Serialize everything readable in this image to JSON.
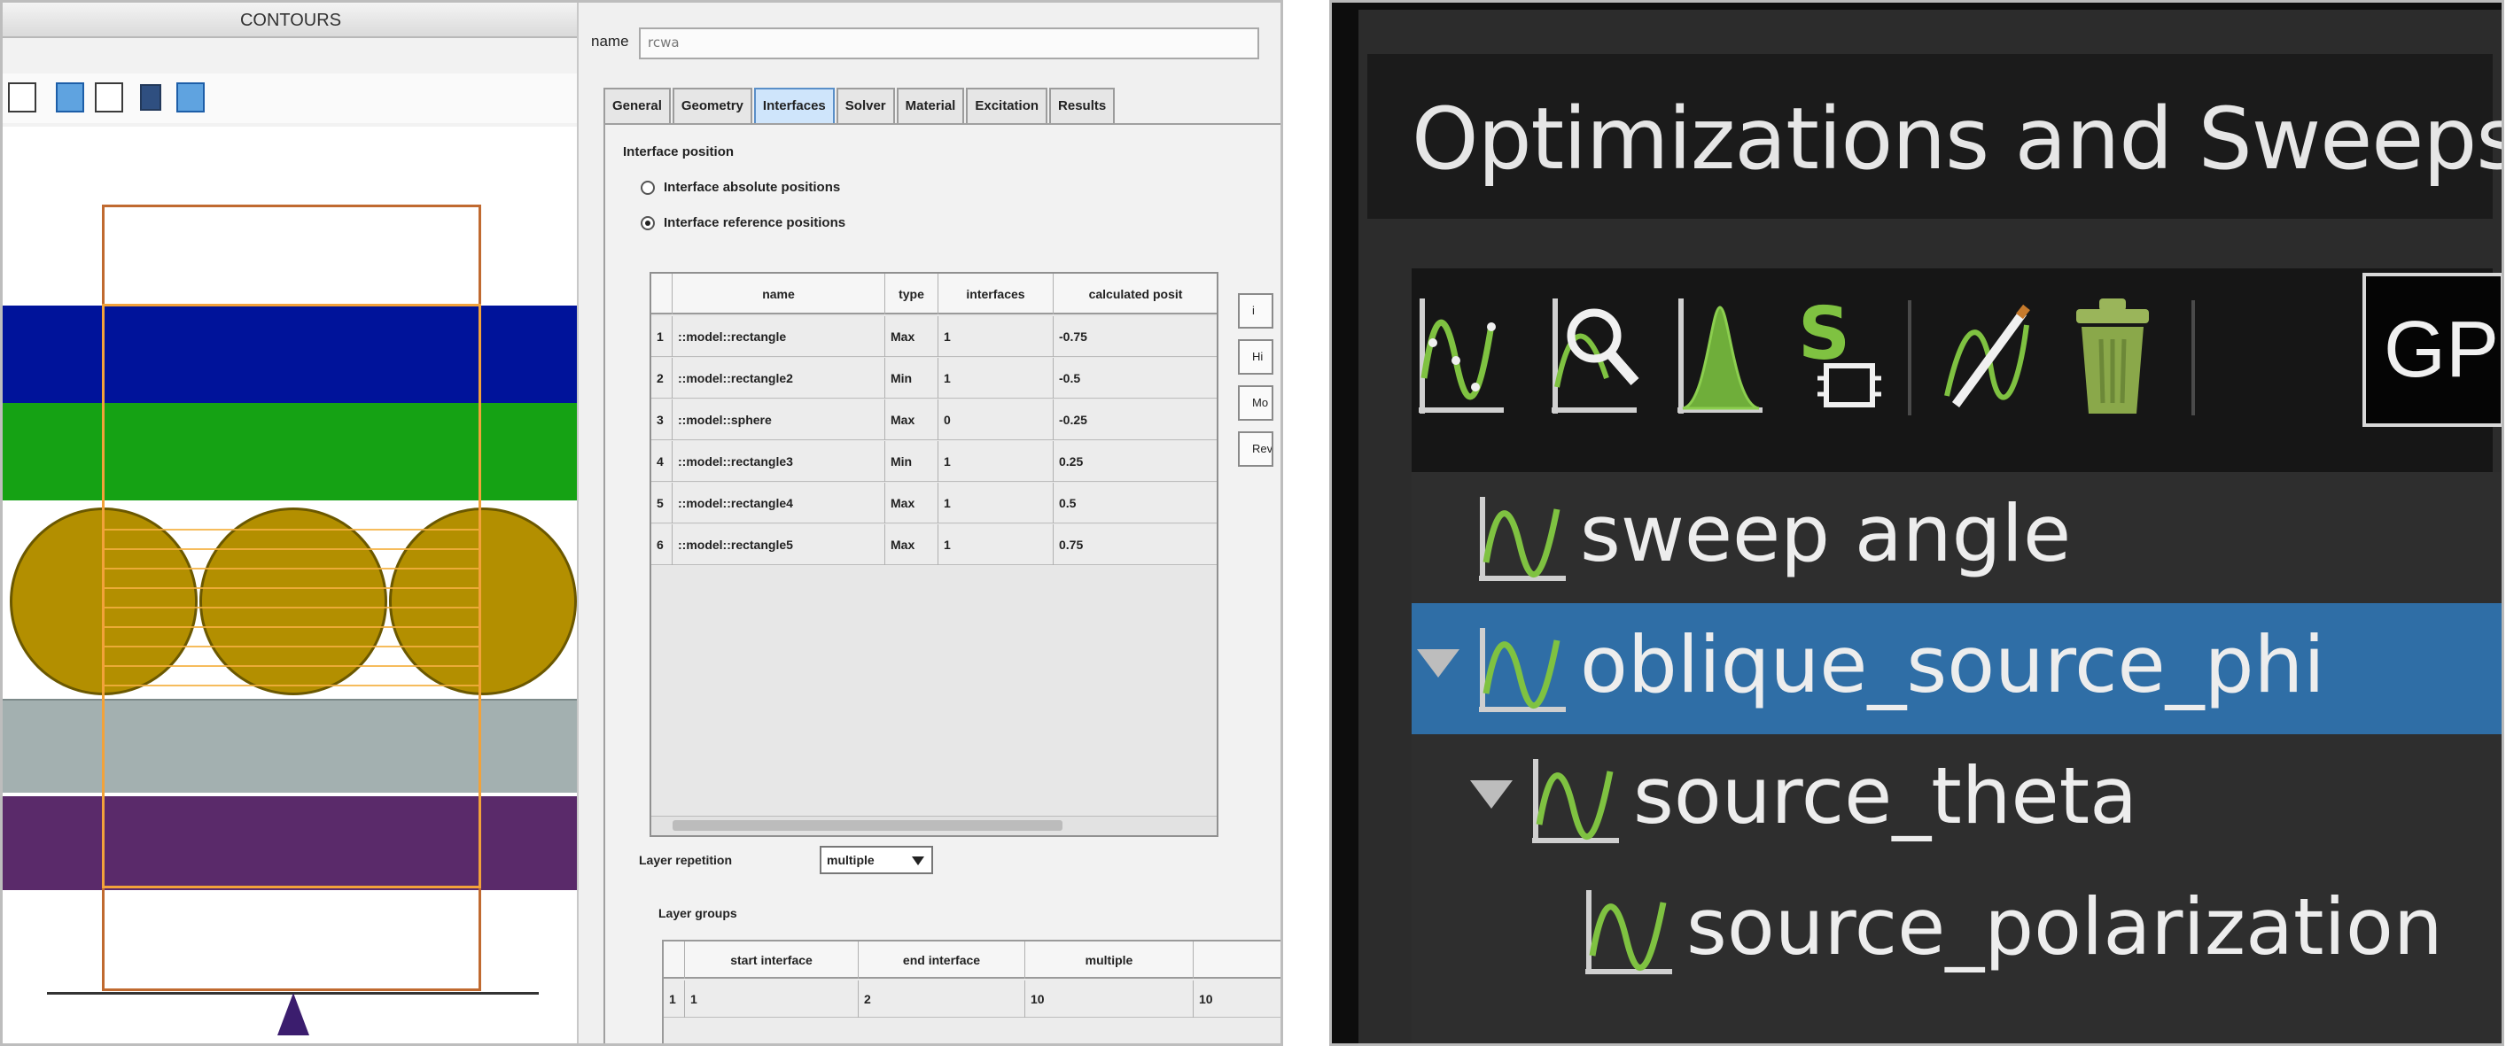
{
  "left_panel": {
    "geometry_view": {
      "title": "CONTOURS"
    },
    "properties": {
      "name_label": "name",
      "name_value": "rcwa",
      "tabs": [
        {
          "label": "General",
          "active": false
        },
        {
          "label": "Geometry",
          "active": false
        },
        {
          "label": "Interfaces",
          "active": true
        },
        {
          "label": "Solver",
          "active": false
        },
        {
          "label": "Material",
          "active": false
        },
        {
          "label": "Excitation",
          "active": false
        },
        {
          "label": "Results",
          "active": false
        }
      ],
      "interface_position_title": "Interface position",
      "radio_options": [
        {
          "label": "Interface absolute positions",
          "checked": false
        },
        {
          "label": "Interface reference positions",
          "checked": true
        }
      ],
      "interface_table": {
        "headers": [
          "",
          "name",
          "type",
          "interfaces",
          "calculated posit"
        ],
        "rows": [
          [
            "1",
            "::model::rectangle",
            "Max",
            "1",
            "-0.75"
          ],
          [
            "2",
            "::model::rectangle2",
            "Min",
            "1",
            "-0.5"
          ],
          [
            "3",
            "::model::sphere",
            "Max",
            "0",
            "-0.25"
          ],
          [
            "4",
            "::model::rectangle3",
            "Min",
            "1",
            "0.25"
          ],
          [
            "5",
            "::model::rectangle4",
            "Max",
            "1",
            "0.5"
          ],
          [
            "6",
            "::model::rectangle5",
            "Max",
            "1",
            "0.75"
          ]
        ]
      },
      "side_buttons": [
        "i",
        "Hi",
        "Mo",
        "Rev"
      ],
      "layer_repetition_label": "Layer repetition",
      "layer_repetition_value": "multiple",
      "layer_groups_label": "Layer groups",
      "groups_table": {
        "headers": [
          "",
          "start interface",
          "end interface",
          "multiple",
          ""
        ],
        "rows": [
          [
            "1",
            "1",
            "2",
            "10",
            "10"
          ]
        ]
      }
    }
  },
  "right_panel": {
    "title": "Optimizations and Sweeps",
    "toolbar_icons": [
      "sweep-icon",
      "optimization-icon",
      "distribution-icon",
      "s-parameter-icon",
      "edit-icon",
      "trash-icon"
    ],
    "resource_select": "GPU",
    "tree": [
      {
        "label": "sweep angle",
        "level": 0,
        "expanded": false,
        "selected": false
      },
      {
        "label": "oblique_source_phi",
        "level": 0,
        "expanded": true,
        "selected": true
      },
      {
        "label": "source_theta",
        "level": 1,
        "expanded": true,
        "selected": false
      },
      {
        "label": "source_polarization",
        "level": 2,
        "expanded": false,
        "selected": false
      }
    ],
    "colors": {
      "selected_row": "#2f6ea6",
      "sweep_curve": "#7fc241",
      "trash": "#8aa84a"
    }
  }
}
